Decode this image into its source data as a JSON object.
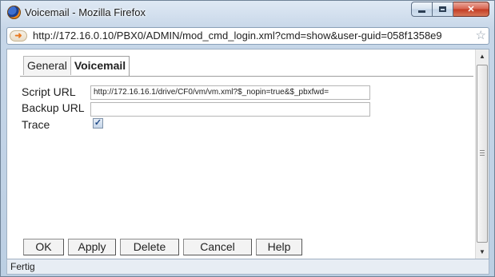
{
  "window": {
    "title": "Voicemail - Mozilla Firefox",
    "icon": "firefox-icon"
  },
  "address_bar": {
    "url": "http://172.16.0.10/PBX0/ADMIN/mod_cmd_login.xml?cmd=show&user-guid=058f1358e9",
    "icon": "page-arrow-icon"
  },
  "tabs": [
    {
      "label": "General",
      "active": false
    },
    {
      "label": "Voicemail",
      "active": true
    }
  ],
  "form": {
    "script_url_label": "Script URL",
    "script_url_value": "http://172.16.16.1/drive/CF0/vm/vm.xml?$_nopin=true&$_pbxfwd=",
    "backup_url_label": "Backup URL",
    "backup_url_value": "",
    "trace_label": "Trace",
    "trace_checked": true
  },
  "buttons": {
    "ok": "OK",
    "apply": "Apply",
    "delete": "Delete",
    "cancel": "Cancel",
    "help": "Help"
  },
  "status": {
    "text": "Fertig"
  }
}
